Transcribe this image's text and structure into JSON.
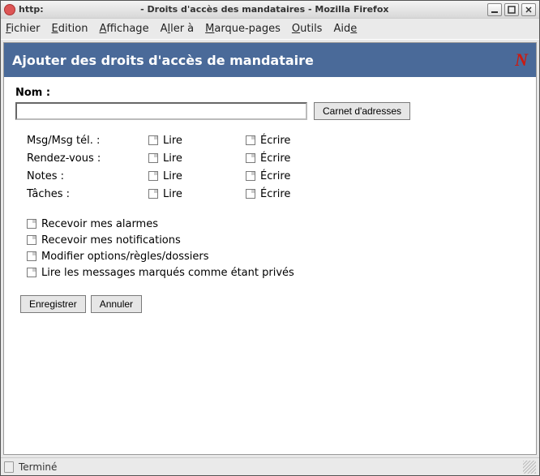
{
  "titlebar": {
    "url": "http:",
    "rest": "- Droits d'accès des mandataires - Mozilla Firefox"
  },
  "menubar": {
    "file": "Fichier",
    "edit": "Edition",
    "view": "Affichage",
    "go": "Aller à",
    "bookmarks": "Marque-pages",
    "tools": "Outils",
    "help": "Aide"
  },
  "page": {
    "title": "Ajouter des droits d'accès de mandataire",
    "brand": "N"
  },
  "form": {
    "name_label": "Nom :",
    "name_value": "",
    "address_book_btn": "Carnet d'adresses",
    "read_label": "Lire",
    "write_label": "Écrire",
    "rows": {
      "mail": "Msg/Msg tél. :",
      "appt": "Rendez-vous :",
      "notes": "Notes :",
      "tasks": "Tâches :"
    },
    "opts": {
      "alarms": "Recevoir mes alarmes",
      "notify": "Recevoir mes notifications",
      "modify": "Modifier options/règles/dossiers",
      "private": "Lire les messages marqués comme étant privés"
    },
    "save_btn": "Enregistrer",
    "cancel_btn": "Annuler"
  },
  "status": {
    "text": "Terminé"
  }
}
